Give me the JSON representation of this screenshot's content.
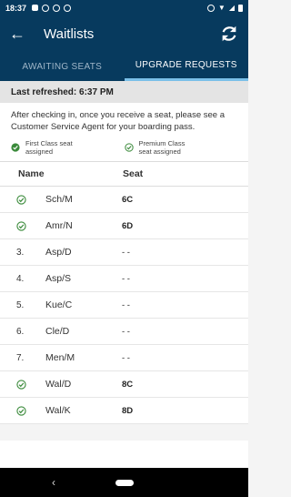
{
  "status_bar": {
    "time": "18:37"
  },
  "app_bar": {
    "title": "Waitlists"
  },
  "tabs": [
    {
      "label": "AWAITING SEATS",
      "active": false
    },
    {
      "label": "UPGRADE REQUESTS",
      "active": true
    }
  ],
  "last_refreshed": "Last refreshed: 6:37 PM",
  "info": {
    "text": "After checking in, once you receive a seat, please see a Customer Service Agent for your boarding pass.",
    "legend": [
      {
        "label": "First Class seat assigned"
      },
      {
        "label": "Premium Class seat assigned"
      }
    ]
  },
  "list": {
    "headers": {
      "name": "Name",
      "seat": "Seat"
    },
    "rows": [
      {
        "position": "",
        "assigned": true,
        "name": "Sch/M",
        "seat": "6C"
      },
      {
        "position": "",
        "assigned": true,
        "name": "Amr/N",
        "seat": "6D"
      },
      {
        "position": "3.",
        "assigned": false,
        "name": "Asp/D",
        "seat": "- -"
      },
      {
        "position": "4.",
        "assigned": false,
        "name": "Asp/S",
        "seat": "- -"
      },
      {
        "position": "5.",
        "assigned": false,
        "name": "Kue/C",
        "seat": "- -"
      },
      {
        "position": "6.",
        "assigned": false,
        "name": "Cle/D",
        "seat": "- -"
      },
      {
        "position": "7.",
        "assigned": false,
        "name": "Men/M",
        "seat": "- -"
      },
      {
        "position": "",
        "assigned": true,
        "name": "Wal/D",
        "seat": "8C"
      },
      {
        "position": "",
        "assigned": true,
        "name": "Wal/K",
        "seat": "8D"
      }
    ]
  },
  "colors": {
    "primary": "#073a5e",
    "tab_indicator": "#7bc0e8",
    "check_green": "#3a8a3a"
  },
  "icons": {
    "back": "arrow-left-icon",
    "refresh": "refresh-icon",
    "assigned": "check-circle-icon"
  }
}
